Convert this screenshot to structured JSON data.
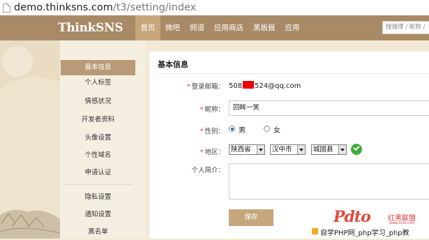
{
  "browser": {
    "url_host": "demo.thinksns.com",
    "url_path": "/t3/setting/index"
  },
  "header": {
    "logo": "ThinkSNS",
    "nav": [
      {
        "label": "首页",
        "active": true
      },
      {
        "label": "微吧"
      },
      {
        "label": "频道"
      },
      {
        "label": "应用商店"
      },
      {
        "label": "黑板报"
      },
      {
        "label": "应用"
      }
    ],
    "search_placeholder": "搜微博 / 昵称 /"
  },
  "sidebar": {
    "items": [
      {
        "label": "基本信息",
        "active": true
      },
      {
        "label": "个人标签"
      },
      {
        "label": "情感状况"
      },
      {
        "label": "开发者资料"
      },
      {
        "label": "头像设置"
      },
      {
        "label": "个性域名"
      },
      {
        "label": "申请认证"
      },
      {
        "label": "隐私设置"
      },
      {
        "label": "通知设置"
      },
      {
        "label": "黑名单"
      }
    ]
  },
  "form": {
    "title": "基本信息",
    "email_label": "登录邮箱：",
    "email_prefix": "508",
    "email_suffix": "524@qq.com",
    "nickname_label": "昵称：",
    "nickname_value": "回眸一笑",
    "gender_label": "性别：",
    "gender_male": "男",
    "gender_female": "女",
    "gender_selected": "男",
    "region_label": "地区：",
    "province": "陕西省",
    "city": "汉中市",
    "county": "城固县",
    "intro_label": "个人简介：",
    "intro_value": "",
    "save_label": "保存"
  },
  "watermark": {
    "brand": "Pdto",
    "brand_cn": "红黑联盟",
    "brand_en": "www.2cto.com",
    "caption": "自学PHP网_php学习_php教"
  },
  "colors": {
    "nav_bg": "#a98a66",
    "accent": "#c6a77d",
    "sidebar_active": "#b99a77",
    "required": "#e33333",
    "check": "#3fae3a"
  }
}
